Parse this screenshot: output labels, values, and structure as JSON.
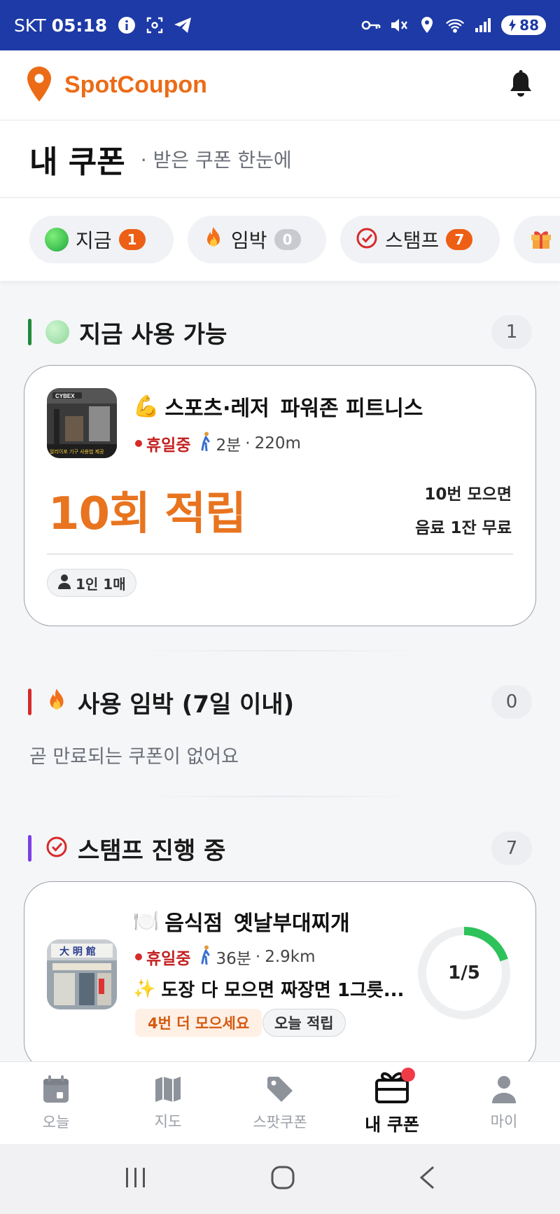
{
  "status_bar": {
    "carrier": "SKT",
    "time": "05:18",
    "battery": "88"
  },
  "app": {
    "name": "SpotCoupon",
    "brand_color": "#ec6b16"
  },
  "page": {
    "title": "내 쿠폰",
    "subtitle": "· 받은 쿠폰 한눈에"
  },
  "filter_chips": [
    {
      "label": "지금",
      "count": "1",
      "icon": "green-circle-icon"
    },
    {
      "label": "임박",
      "count": "0",
      "icon": "fire-icon"
    },
    {
      "label": "스탬프",
      "count": "7",
      "icon": "check-circle-icon"
    },
    {
      "label": "",
      "icon": "gift-icon"
    }
  ],
  "sections": {
    "available": {
      "title": "지금 사용 가능",
      "count": "1",
      "accent": "#1e8a3a"
    },
    "expiring": {
      "title": "사용 임박 (7일 이내)",
      "count": "0",
      "accent": "#d62b2b",
      "empty_text": "곧 만료되는 쿠폰이 없어요"
    },
    "stamps": {
      "title": "스탬프 진행 중",
      "count": "7",
      "accent": "#7b3fe4"
    }
  },
  "coupon_card": {
    "category_emoji": "💪",
    "category": "스포츠·레저",
    "store": "파워존 피트니스",
    "status": "휴일중",
    "walk_time": "2분",
    "distance": "220m",
    "reward_big": "10회 적립",
    "reward_condition_line1": "10번 모으면",
    "reward_condition_line2": "음료 1잔 무료",
    "limit": "1인 1매",
    "thumb_caption": "알리이포 기구 사용법 제공"
  },
  "stamp_card": {
    "category_emoji": "🍽️",
    "category": "음식점",
    "store": "옛날부대찌개",
    "status": "휴일중",
    "walk_time": "36분",
    "distance": "2.9km",
    "reward_emoji": "✨",
    "reward": "도장 다 모으면 짜장면 1그릇...",
    "remaining": "4번 더 모으세요",
    "today_label": "오늘 적립",
    "progress_text": "1/5",
    "progress": 0.2,
    "progress_color": "#2ec25a"
  },
  "bottom_nav": [
    {
      "label": "오늘",
      "icon": "calendar-icon"
    },
    {
      "label": "지도",
      "icon": "map-icon"
    },
    {
      "label": "스팟쿠폰",
      "icon": "tag-icon"
    },
    {
      "label": "내 쿠폰",
      "icon": "coupon-box-icon",
      "active": true
    },
    {
      "label": "마이",
      "icon": "person-icon"
    }
  ]
}
